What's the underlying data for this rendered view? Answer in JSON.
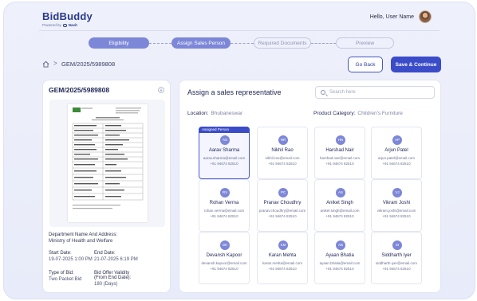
{
  "brand": {
    "name": "BidBuddy",
    "powered_by": "Powered by",
    "powered_company": "Navit"
  },
  "header": {
    "greeting": "Hello, User Name"
  },
  "steps": [
    {
      "label": "Eligibility",
      "state": "active"
    },
    {
      "label": "Assign Sales Person",
      "state": "active"
    },
    {
      "label": "Required Documents",
      "state": "inactive"
    },
    {
      "label": "Preview",
      "state": "inactive"
    }
  ],
  "breadcrumb": {
    "separator": ">",
    "current": "GEM/2025/5989808"
  },
  "actions": {
    "back_label": "Go Back",
    "save_label": "Save & Continue"
  },
  "document": {
    "title": "GEM/2025/5989808",
    "department_label": "Department Name And Address:",
    "department_value": "Ministry of Health and Welfare",
    "start_date_label": "Start Date:",
    "start_date_value": "19-07-2025 1:00 PM",
    "end_date_label": "End Date:",
    "end_date_value": "21-07-2025 6:19 PM",
    "bid_type_label": "Type of Bid:",
    "bid_type_value": "Two Packet Bid",
    "validity_label_1": "Bid Offer Validity",
    "validity_label_2": "(From End Date):",
    "validity_value": "180 (Days)"
  },
  "assign": {
    "title": "Assign a sales representative",
    "search_placeholder": "Search here",
    "location_label": "Location:",
    "location_value": "Bhubaneswar",
    "category_label": "Product Category:",
    "category_value": "Children's Furniture",
    "selected_tag": "Assigned Person"
  },
  "reps": [
    {
      "initials": "AS",
      "name": "Aarav Sharma",
      "email": "aarav.sharma@email.com",
      "phone": "+91 94674 82510",
      "selected": true
    },
    {
      "initials": "NR",
      "name": "Nikhil Rao",
      "email": "nikhil.rao@email.com",
      "phone": "+91 94674 82510",
      "selected": false
    },
    {
      "initials": "HN",
      "name": "Harshad Nair",
      "email": "harshad.nair@email.com",
      "phone": "+91 94674 82510",
      "selected": false
    },
    {
      "initials": "AP",
      "name": "Arjun Patel",
      "email": "arjun.patel@email.com",
      "phone": "+91 94674 82510",
      "selected": false
    },
    {
      "initials": "RV",
      "name": "Rohan Verma",
      "email": "rohan.verma@email.com",
      "phone": "+91 94674 82510",
      "selected": false
    },
    {
      "initials": "PC",
      "name": "Pranav Choudhry",
      "email": "pranav.choudhry@email.com",
      "phone": "+91 94674 82510",
      "selected": false
    },
    {
      "initials": "AS",
      "name": "Aniket Singh",
      "email": "aniket.singh@email.com",
      "phone": "+91 94674 82510",
      "selected": false
    },
    {
      "initials": "VJ",
      "name": "Vikram Joshi",
      "email": "vikram.joshi@email.com",
      "phone": "+91 94674 82510",
      "selected": false
    },
    {
      "initials": "DK",
      "name": "Devansh Kapoor",
      "email": "devansh.kapoor@email.com",
      "phone": "+91 94674 82510",
      "selected": false
    },
    {
      "initials": "KM",
      "name": "Karan Mehta",
      "email": "karan.mehta@email.com",
      "phone": "+91 94674 82510",
      "selected": false
    },
    {
      "initials": "AB",
      "name": "Ayaan Bhatia",
      "email": "ayaan.bhatia@email.com",
      "phone": "+91 94674 82510",
      "selected": false
    },
    {
      "initials": "SI",
      "name": "Siddharth Iyer",
      "email": "siddharth.iyer@email.com",
      "phone": "+91 94674 82510",
      "selected": false
    }
  ]
}
